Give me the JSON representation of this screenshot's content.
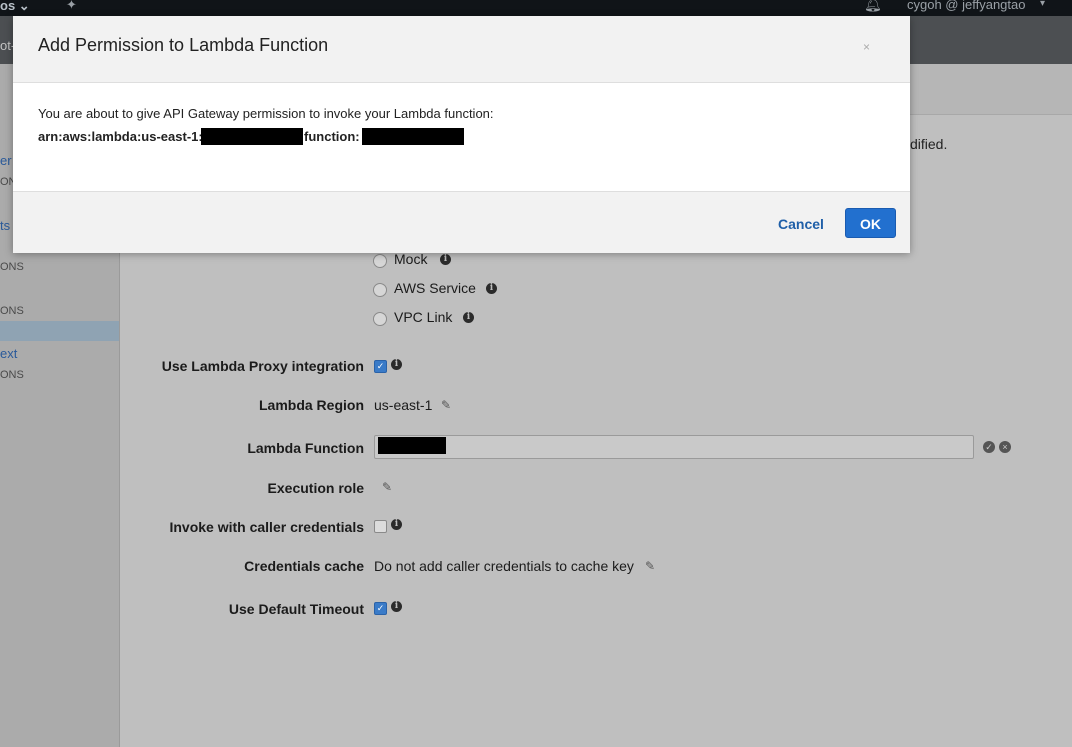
{
  "topbar": {
    "services_label": "os",
    "services_caret": "⌄",
    "pin_icon": "pin-icon",
    "bell_icon": "bell-icon",
    "user_label": "cygoh @ jeffyangtao",
    "user_caret": "▾"
  },
  "subbar": {
    "crumb": "ot-"
  },
  "sidebar": {
    "items": [
      {
        "label": "er",
        "sub": "ONS"
      },
      {
        "label": "ts",
        "sub": "ONS"
      },
      {
        "label": "",
        "sub": "ONS"
      },
      {
        "label": "ext",
        "sub": "ONS"
      }
    ]
  },
  "background_note": "dified.",
  "integration_types": [
    {
      "label": "Mock"
    },
    {
      "label": "AWS Service"
    },
    {
      "label": "VPC Link"
    }
  ],
  "form": {
    "proxy_label": "Use Lambda Proxy integration",
    "proxy_checked": "✓",
    "region_label": "Lambda Region",
    "region_value": "us-east-1",
    "function_label": "Lambda Function",
    "role_label": "Execution role",
    "caller_creds_label": "Invoke with caller credentials",
    "cache_label": "Credentials cache",
    "cache_value": "Do not add caller credentials to cache key",
    "timeout_label": "Use Default Timeout",
    "timeout_checked": "✓",
    "confirm_icon": "✓",
    "cancel_icon": "×"
  },
  "modal": {
    "title": "Add Permission to Lambda Function",
    "close": "×",
    "message": "You are about to give API Gateway permission to invoke your Lambda function:",
    "arn_prefix": "arn:aws:lambda:us-east-1:",
    "arn_mid": "function:",
    "cancel_label": "Cancel",
    "ok_label": "OK"
  },
  "info_glyph": "i",
  "pencil_glyph": "✎",
  "colors": {
    "primary": "#2270cf",
    "link": "#1f5fa8",
    "overlay": "#bfbfbf"
  }
}
